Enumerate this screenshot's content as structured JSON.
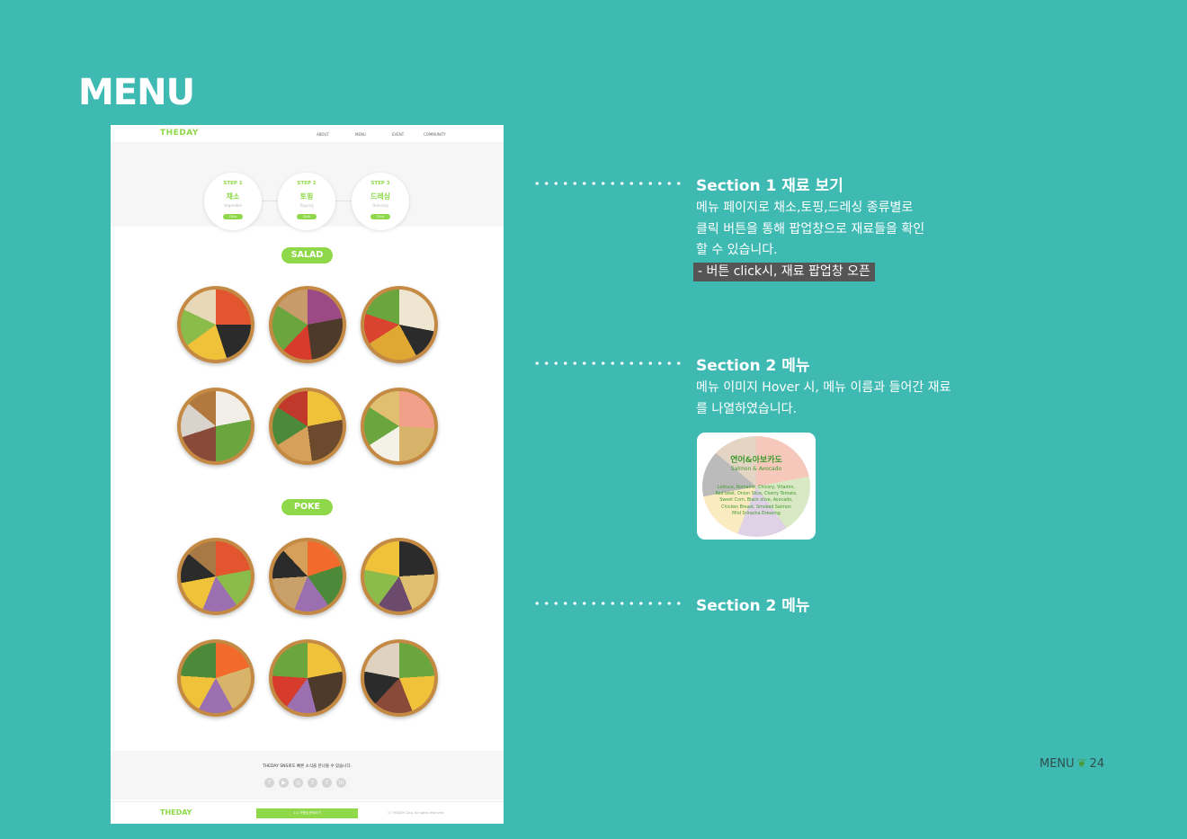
{
  "page": {
    "heading": "MENU"
  },
  "mockup": {
    "logo": "THEDAY",
    "nav": [
      "ABOUT",
      "MENU",
      "EVENT",
      "COMMUNITY"
    ],
    "steps": [
      {
        "no": "STEP 1",
        "title": "채소",
        "sub": "Vegetable",
        "btn": "Click"
      },
      {
        "no": "STEP 2",
        "title": "토핑",
        "sub": "Topping",
        "btn": "Click"
      },
      {
        "no": "STEP 3",
        "title": "드레싱",
        "sub": "Dressing",
        "btn": "Click"
      }
    ],
    "categories": [
      "SALAD",
      "POKE"
    ],
    "sns_text": "THEDAY SNS로도 빠른 소식을 만나볼 수 있습니다.",
    "sns_icons": [
      "facebook-icon",
      "youtube-icon",
      "instagram-icon",
      "tiktok-icon",
      "twitter-icon",
      "linkedin-icon"
    ],
    "footer_btn": "1:1 가맹점 문의하기",
    "copyright": "ⓒ THEDAY Corp. All rights reserved.",
    "accent_color": "#8fd84a"
  },
  "sections": [
    {
      "title": "Section 1 재료 보기",
      "lines": [
        "메뉴 페이지로 채소,토핑,드레싱 종류별로",
        "클릭 버튼을 통해 팝업창으로 재료들을 확인",
        "할 수 있습니다."
      ],
      "highlight": "- 버튼 click시, 재료 팝업창 오픈"
    },
    {
      "title": "Section 2 메뉴",
      "lines": [
        "메뉴 이미지 Hover 시, 메뉴 이름과 들어간 재료",
        "를 나열하였습니다."
      ]
    },
    {
      "title": "Section 2 메뉴"
    }
  ],
  "hover_card": {
    "name": "연어&아보카도",
    "en": "Salmon & Avocado",
    "ingredients": [
      "Lettuce, Romaine, Chicory, Vitamin,",
      "Red beet, Onion Slice, Cherry Tomato,",
      "Sweet Corn, Black olive, Avocado,",
      "Chicken Breast, Smoked Salmon",
      "Mild Sriracha Dressing"
    ]
  },
  "page_number": {
    "label": "MENU",
    "number": "24"
  },
  "background_color": "#3fbab3"
}
